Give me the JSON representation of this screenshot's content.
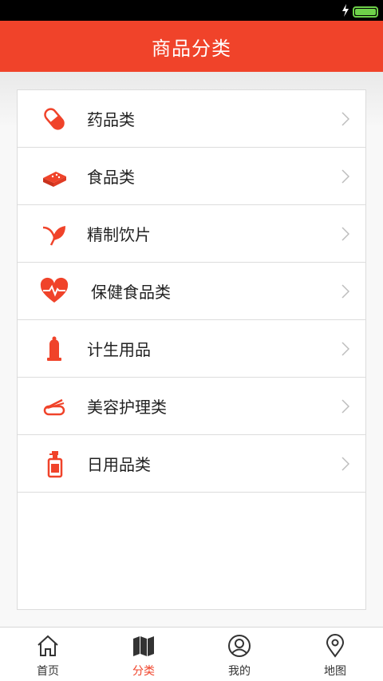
{
  "status_bar": {
    "icons": [
      "charging-icon",
      "battery-icon"
    ],
    "battery_color": "#6fd24a"
  },
  "header": {
    "title": "商品分类",
    "background": "#f0432a"
  },
  "categories": [
    {
      "label": "药品类",
      "icon": "pill-icon"
    },
    {
      "label": "食品类",
      "icon": "food-icon"
    },
    {
      "label": "精制饮片",
      "icon": "leaf-icon"
    },
    {
      "label": "保健食品类",
      "icon": "heart-pulse-icon"
    },
    {
      "label": "计生用品",
      "icon": "condom-icon"
    },
    {
      "label": "美容护理类",
      "icon": "cosmetic-icon"
    },
    {
      "label": "日用品类",
      "icon": "spray-bottle-icon"
    }
  ],
  "tabbar": {
    "active_color": "#f0432a",
    "tabs": [
      {
        "label": "首页",
        "icon": "home-icon"
      },
      {
        "label": "分类",
        "icon": "map-book-icon",
        "active": true
      },
      {
        "label": "我的",
        "icon": "user-icon"
      },
      {
        "label": "地图",
        "icon": "location-pin-icon"
      }
    ]
  }
}
